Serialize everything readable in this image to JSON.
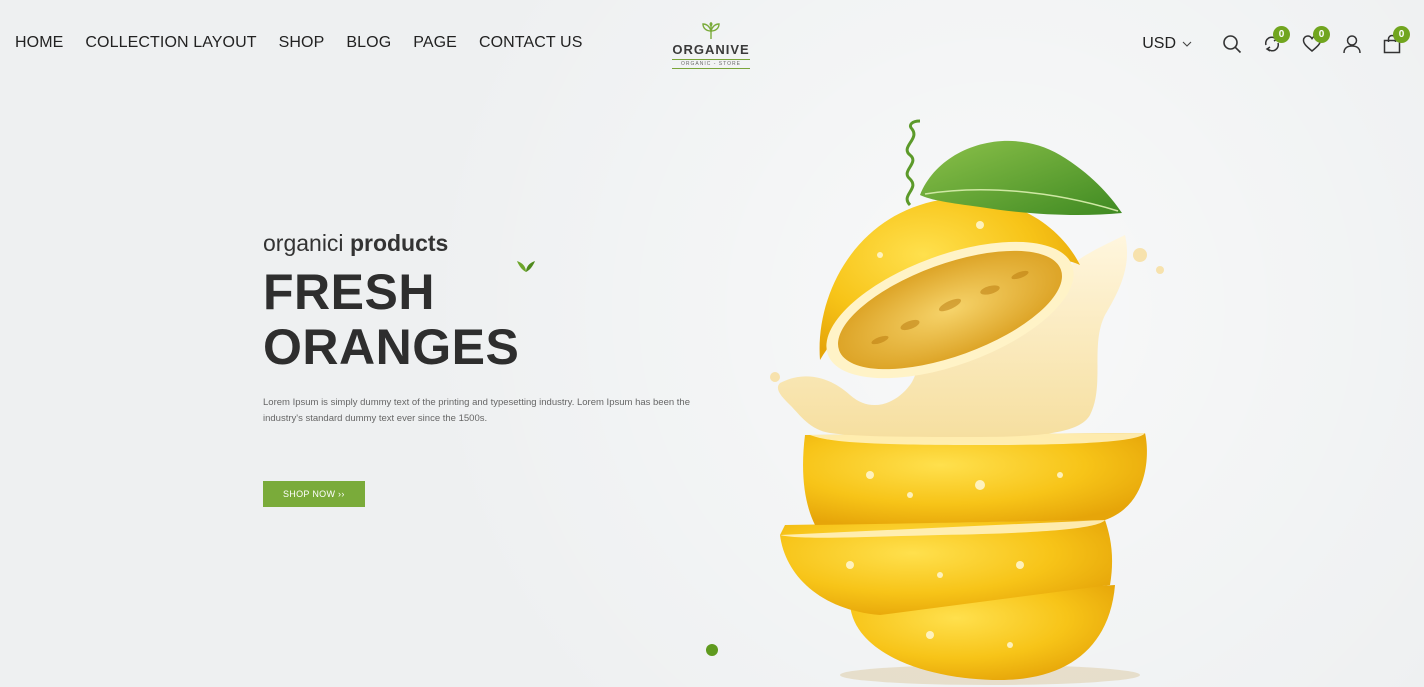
{
  "header": {
    "nav": [
      "HOME",
      "COLLECTION LAYOUT",
      "SHOP",
      "BLOG",
      "PAGE",
      "CONTACT US"
    ],
    "logo": {
      "brand": "ORGANIVE",
      "sub": "ORGANIC - STORE"
    },
    "currency": "USD",
    "compare_count": "0",
    "wishlist_count": "0",
    "cart_count": "0"
  },
  "hero": {
    "tagline_light": "organici ",
    "tagline_bold": "products",
    "headline": "FRESH ORANGES",
    "description": "Lorem Ipsum is simply dummy text of the printing and typesetting industry. Lorem Ipsum has been the industry's standard dummy text ever since the 1500s.",
    "button": "SHOP NOW ››"
  },
  "colors": {
    "accent_green": "#7aab3a",
    "badge_green": "#71a51f"
  },
  "icons": [
    "chevron-down-icon",
    "search-icon",
    "compare-icon",
    "heart-icon",
    "user-icon",
    "bag-icon",
    "leaf-icon"
  ]
}
